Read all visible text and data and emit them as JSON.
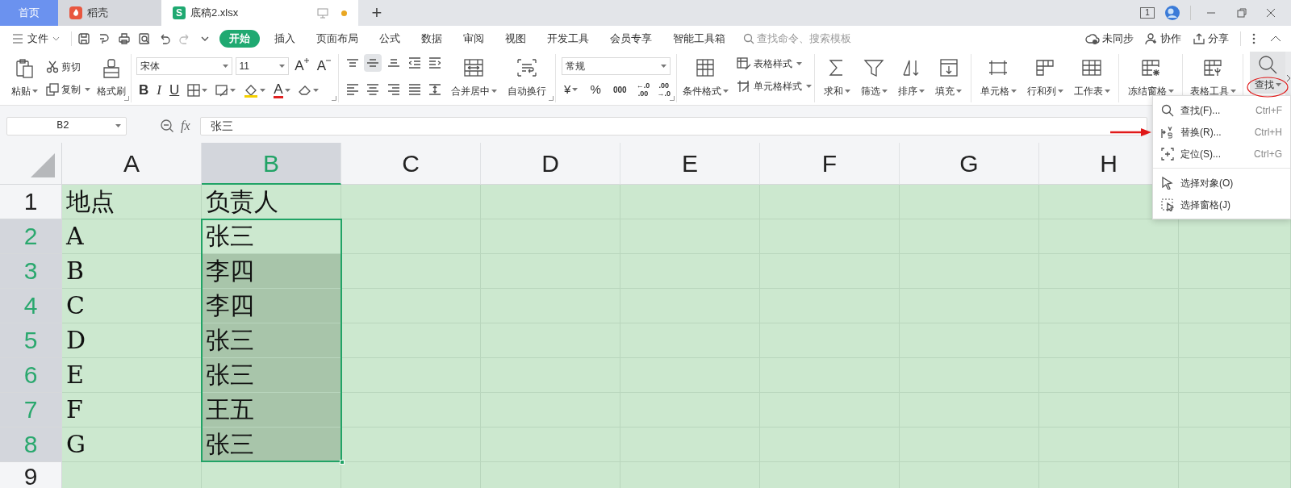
{
  "tabs": [
    {
      "kind": "home",
      "label": "首页",
      "selected": false
    },
    {
      "kind": "docer",
      "label": "稻壳",
      "selected": false
    },
    {
      "kind": "sheet",
      "label": "底稿2.xlsx",
      "badge": "S",
      "unsaved": true,
      "selected": true
    }
  ],
  "new_tab": "+",
  "window_controls": {
    "layout_badge": "1"
  },
  "menu": {
    "file": "文件",
    "tabs": [
      {
        "label": "开始",
        "selected": true
      },
      {
        "label": "插入",
        "selected": false
      },
      {
        "label": "页面布局",
        "selected": false
      },
      {
        "label": "公式",
        "selected": false
      },
      {
        "label": "数据",
        "selected": false
      },
      {
        "label": "审阅",
        "selected": false
      },
      {
        "label": "视图",
        "selected": false
      },
      {
        "label": "开发工具",
        "selected": false
      },
      {
        "label": "会员专享",
        "selected": false
      },
      {
        "label": "智能工具箱",
        "selected": false
      }
    ],
    "search": {
      "placeholder": "查找命令、搜索模板"
    },
    "actions": [
      "未同步",
      "协作",
      "分享"
    ]
  },
  "ribbon": {
    "clipboard": {
      "paste": "粘贴",
      "cut": "剪切",
      "copy": "复制",
      "format_painter": "格式刷"
    },
    "font": {
      "name": "宋体",
      "size": "11",
      "grow": "A",
      "shrink": "A",
      "bold": "B",
      "italic": "I",
      "underline": "U",
      "font_color": "A"
    },
    "alignment": {
      "merge": "合并居中",
      "wrap": "自动换行"
    },
    "number": {
      "format": "常规",
      "currency": "¥",
      "percent": "%",
      "thousands": "000",
      "increase_decimal": [
        "←.0",
        ".00"
      ],
      "decrease_decimal": [
        ".00",
        "→.0"
      ]
    },
    "styles": {
      "conditional": "条件格式",
      "table_style": "表格样式",
      "cell_style": "单元格样式"
    },
    "groups": [
      [
        "求和",
        "筛选",
        "排序",
        "填充"
      ],
      [
        "单元格",
        "行和列",
        "工作表"
      ],
      [
        "冻结窗格"
      ],
      [
        "表格工具"
      ]
    ],
    "find": {
      "label": "查找",
      "selected": true
    }
  },
  "formula_bar": {
    "name_box": "B2",
    "fx": "fx",
    "value": "张三"
  },
  "sheet": {
    "columns": [
      {
        "label": "A",
        "selected": false
      },
      {
        "label": "B",
        "selected": true
      },
      {
        "label": "C",
        "selected": false
      },
      {
        "label": "D",
        "selected": false
      },
      {
        "label": "E",
        "selected": false
      },
      {
        "label": "F",
        "selected": false
      },
      {
        "label": "G",
        "selected": false
      },
      {
        "label": "H",
        "selected": false
      }
    ],
    "rows": [
      {
        "number": "1",
        "selected": false,
        "cells": [
          {
            "text": "地点",
            "selected": false
          },
          {
            "text": "负责人",
            "selected": false
          }
        ]
      },
      {
        "number": "2",
        "selected": true,
        "cells": [
          {
            "text": "A",
            "selected": false
          },
          {
            "text": "张三",
            "selected": false,
            "active": true
          }
        ]
      },
      {
        "number": "3",
        "selected": true,
        "cells": [
          {
            "text": "B",
            "selected": false
          },
          {
            "text": "李四",
            "selected": true
          }
        ]
      },
      {
        "number": "4",
        "selected": true,
        "cells": [
          {
            "text": "C",
            "selected": false
          },
          {
            "text": "李四",
            "selected": true
          }
        ]
      },
      {
        "number": "5",
        "selected": true,
        "cells": [
          {
            "text": "D",
            "selected": false
          },
          {
            "text": "张三",
            "selected": true
          }
        ]
      },
      {
        "number": "6",
        "selected": true,
        "cells": [
          {
            "text": "E",
            "selected": false
          },
          {
            "text": "张三",
            "selected": true
          }
        ]
      },
      {
        "number": "7",
        "selected": true,
        "cells": [
          {
            "text": "F",
            "selected": false
          },
          {
            "text": "王五",
            "selected": true
          }
        ]
      },
      {
        "number": "8",
        "selected": true,
        "cells": [
          {
            "text": "G",
            "selected": false
          },
          {
            "text": "张三",
            "selected": true
          }
        ]
      },
      {
        "number": "9",
        "selected": false
      }
    ]
  },
  "find_menu": {
    "groups": [
      [
        {
          "label": "查找(F)...",
          "shortcut": "Ctrl+F"
        },
        {
          "label": "替换(R)...",
          "shortcut": "Ctrl+H"
        },
        {
          "label": "定位(S)...",
          "shortcut": "Ctrl+G"
        }
      ],
      [
        {
          "label": "选择对象(O)"
        },
        {
          "label": "选择窗格(J)"
        }
      ]
    ]
  }
}
